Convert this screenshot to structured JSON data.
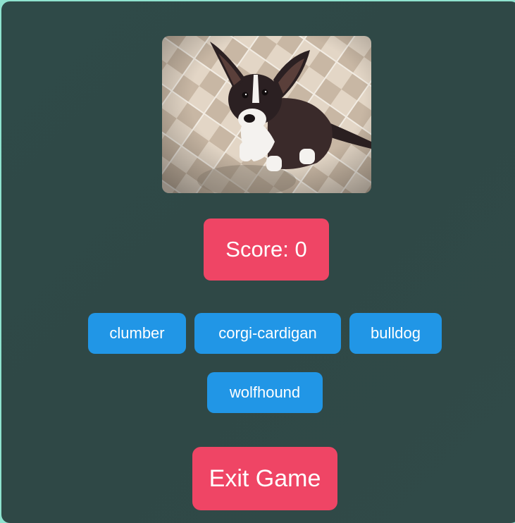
{
  "game": {
    "score_text": "Score: 0",
    "choices": [
      {
        "label": "clumber"
      },
      {
        "label": "corgi-cardigan"
      },
      {
        "label": "bulldog"
      },
      {
        "label": "wolfhound"
      }
    ],
    "exit_label": "Exit Game"
  },
  "image": {
    "subject": "dog-photo"
  },
  "colors": {
    "background_outer": "#8fe3cf",
    "panel": "#2f4846",
    "accent_red": "#ef4565",
    "choice_blue": "#2196e6",
    "text": "#ffffff"
  }
}
